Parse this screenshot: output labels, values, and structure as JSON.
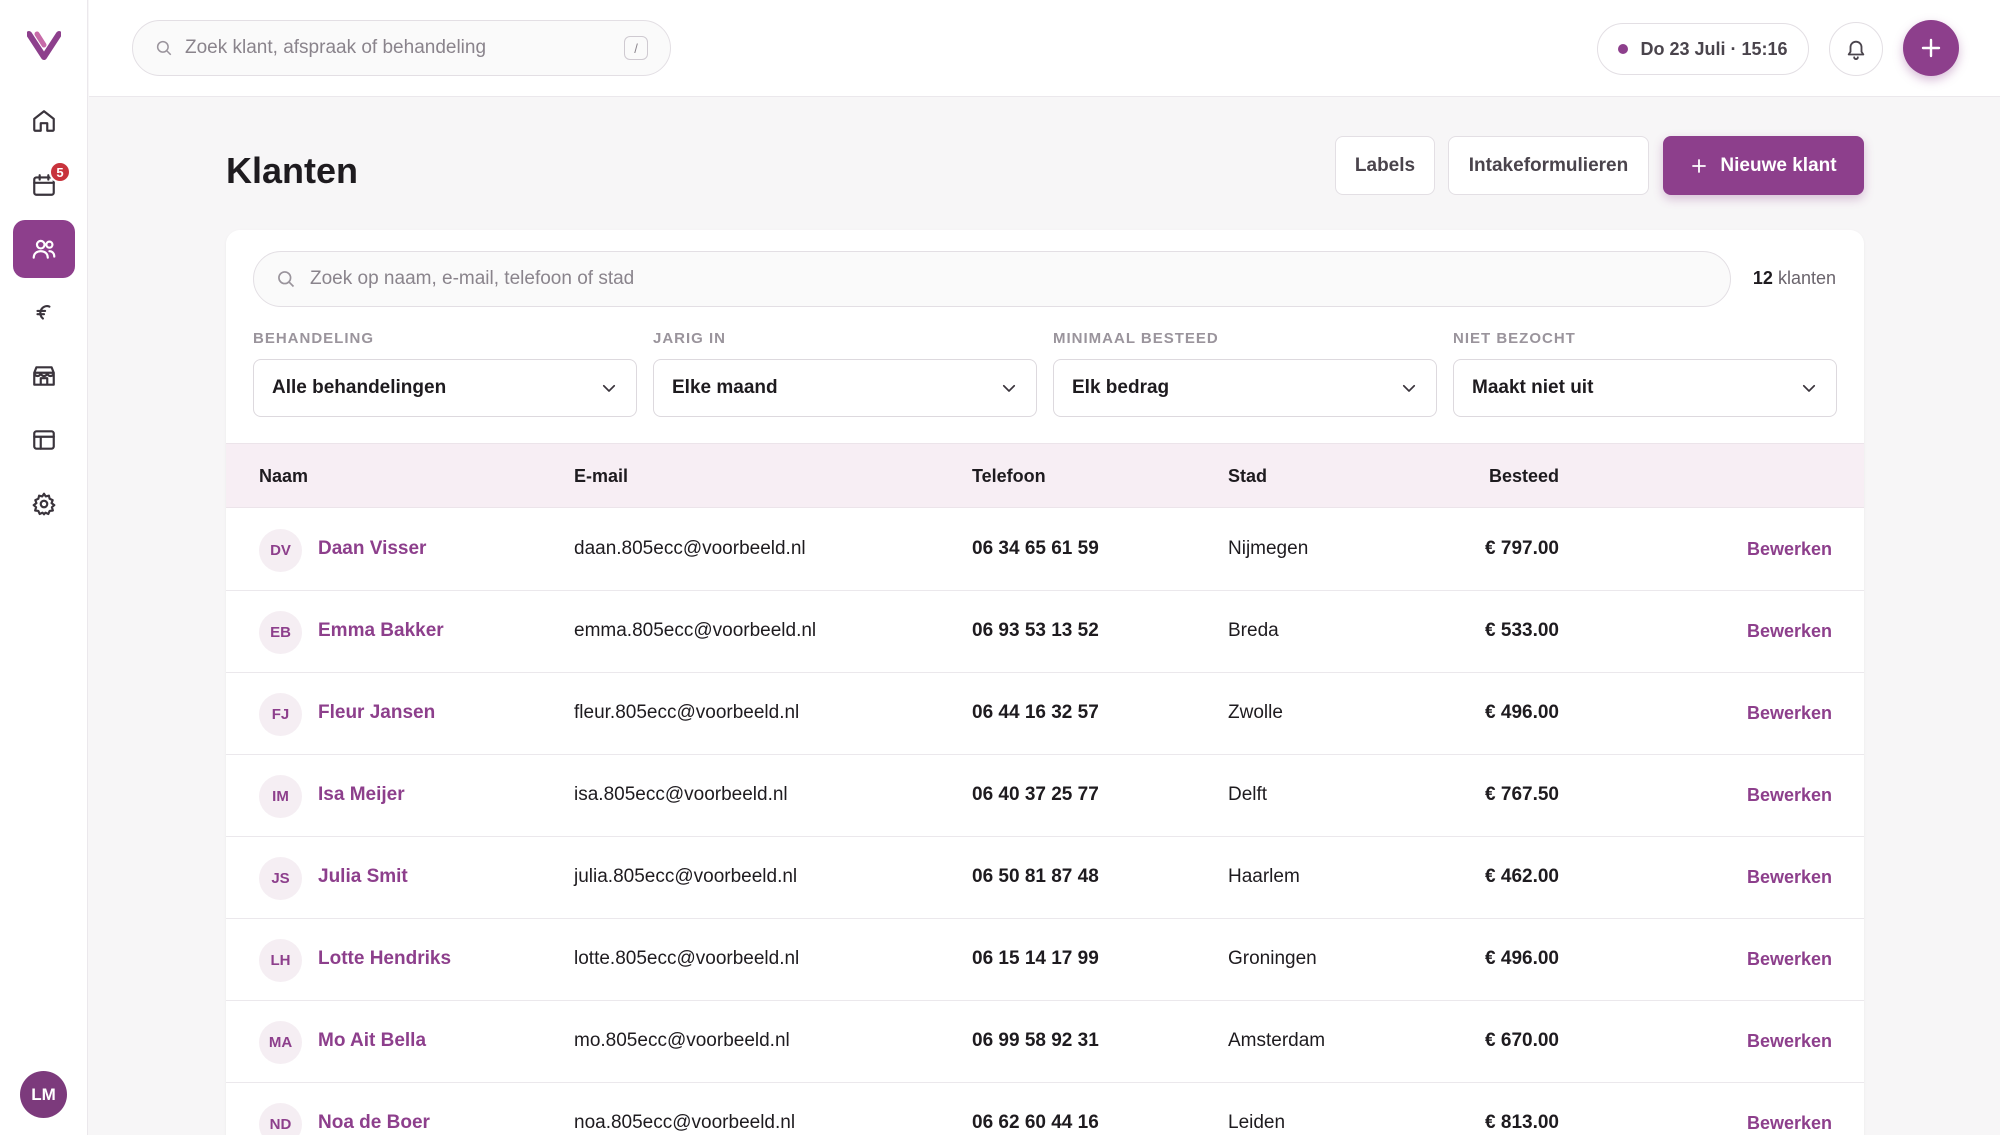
{
  "sidebar": {
    "badge_count": "5",
    "nav": [
      {
        "id": "home",
        "icon": "home-icon"
      },
      {
        "id": "calendar",
        "icon": "calendar-icon"
      },
      {
        "id": "clients",
        "icon": "users-icon",
        "active": true
      },
      {
        "id": "finance",
        "icon": "euro-icon"
      },
      {
        "id": "shop",
        "icon": "store-icon"
      },
      {
        "id": "layout",
        "icon": "layout-icon"
      },
      {
        "id": "settings",
        "icon": "gear-icon"
      }
    ],
    "user_initials": "LM"
  },
  "topbar": {
    "search_placeholder": "Zoek klant, afspraak of behandeling",
    "search_shortcut": "/",
    "datetime": "Do 23 Juli · 15:16"
  },
  "page": {
    "title": "Klanten",
    "labels_button": "Labels",
    "intake_button": "Intakeformulieren",
    "new_client_button": "Nieuwe klant"
  },
  "table_search": {
    "placeholder": "Zoek op naam, e-mail, telefoon of stad",
    "count": "12",
    "count_label": "klanten"
  },
  "filters": [
    {
      "label": "BEHANDELING",
      "value": "Alle behandelingen"
    },
    {
      "label": "JARIG IN",
      "value": "Elke maand"
    },
    {
      "label": "MINIMAAL BESTEED",
      "value": "Elk bedrag"
    },
    {
      "label": "NIET BEZOCHT",
      "value": "Maakt niet uit"
    }
  ],
  "table": {
    "headers": {
      "name": "Naam",
      "email": "E-mail",
      "phone": "Telefoon",
      "city": "Stad",
      "spent": "Besteed"
    },
    "edit_label": "Bewerken",
    "rows": [
      {
        "initials": "DV",
        "name": "Daan Visser",
        "email": "daan.805ecc@voorbeeld.nl",
        "phone": "06 34 65 61 59",
        "city": "Nijmegen",
        "spent": "€ 797.00"
      },
      {
        "initials": "EB",
        "name": "Emma Bakker",
        "email": "emma.805ecc@voorbeeld.nl",
        "phone": "06 93 53 13 52",
        "city": "Breda",
        "spent": "€ 533.00"
      },
      {
        "initials": "FJ",
        "name": "Fleur Jansen",
        "email": "fleur.805ecc@voorbeeld.nl",
        "phone": "06 44 16 32 57",
        "city": "Zwolle",
        "spent": "€ 496.00"
      },
      {
        "initials": "IM",
        "name": "Isa Meijer",
        "email": "isa.805ecc@voorbeeld.nl",
        "phone": "06 40 37 25 77",
        "city": "Delft",
        "spent": "€ 767.50"
      },
      {
        "initials": "JS",
        "name": "Julia Smit",
        "email": "julia.805ecc@voorbeeld.nl",
        "phone": "06 50 81 87 48",
        "city": "Haarlem",
        "spent": "€ 462.00"
      },
      {
        "initials": "LH",
        "name": "Lotte Hendriks",
        "email": "lotte.805ecc@voorbeeld.nl",
        "phone": "06 15 14 17 99",
        "city": "Groningen",
        "spent": "€ 496.00"
      },
      {
        "initials": "MA",
        "name": "Mo Ait Bella",
        "email": "mo.805ecc@voorbeeld.nl",
        "phone": "06 99 58 92 31",
        "city": "Amsterdam",
        "spent": "€ 670.00"
      },
      {
        "initials": "ND",
        "name": "Noa de Boer",
        "email": "noa.805ecc@voorbeeld.nl",
        "phone": "06 62 60 44 16",
        "city": "Leiden",
        "spent": "€ 813.00"
      }
    ]
  },
  "colors": {
    "accent": "#8d3f8c",
    "badge": "#c8333c",
    "header_bg": "#f7eef4"
  }
}
